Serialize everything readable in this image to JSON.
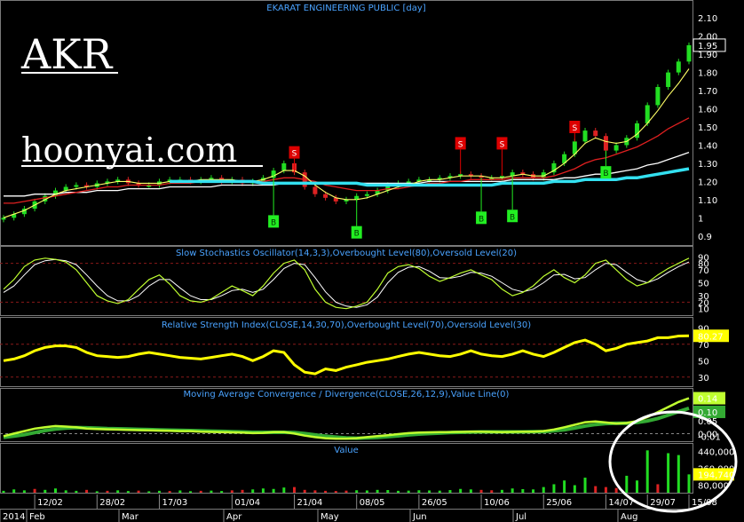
{
  "title": "EKARAT ENGINEERING PUBLIC [day]",
  "overlay": {
    "ticker": "AKR",
    "site": "hoonyai.com"
  },
  "colors": {
    "up": "#22dd22",
    "down": "#dd2222",
    "grid": "#8a1a1a",
    "cyan": "#33e0f0",
    "signal_s": "#dd0000",
    "signal_b": "#22ee22"
  },
  "panels": {
    "price": {
      "ticks": [
        "2.10",
        "2.00",
        "1.90",
        "1.80",
        "1.70",
        "1.60",
        "1.50",
        "1.40",
        "1.30",
        "1.20",
        "1.10",
        "1",
        "0.9"
      ],
      "last_label": "1.95",
      "buy_label": "B",
      "sell_label": "S"
    },
    "stochastic": {
      "title": "Slow Stochastics Oscillator(14,3,3),Overbought Level(80),Oversold Level(20)",
      "ticks": [
        "90",
        "80",
        "70",
        "50",
        "30",
        "20",
        "10"
      ]
    },
    "rsi": {
      "title": "Relative Strength Index(CLOSE,14,30,70),Overbought Level(70),Oversold Level(30)",
      "ticks": [
        "90",
        "70",
        "50",
        "30"
      ],
      "last_label": "80.27"
    },
    "macd": {
      "title": "Moving Average Convergence / Divergence(CLOSE,26,12,9),Value Line(0)",
      "ticks": [
        "0.05",
        "0.00",
        "-0.01"
      ],
      "last_labels": [
        "0.14",
        "0.10"
      ]
    },
    "value": {
      "title": "Value",
      "ticks": [
        "440,000",
        "260,000",
        "80,000"
      ],
      "last_label": "194,740"
    }
  },
  "x_axis": {
    "dates": [
      "12/02",
      "28/02",
      "17/03",
      "01/04",
      "21/04",
      "08/05",
      "26/05",
      "10/06",
      "25/06",
      "14/07",
      "29/07",
      "15/08"
    ],
    "months": [
      "2014",
      "Feb",
      "Mar",
      "Apr",
      "May",
      "Jun",
      "Jul",
      "Aug"
    ]
  },
  "chart_data": {
    "type": "line",
    "x_range": [
      "2014-01",
      "2014-08-20"
    ],
    "price": {
      "ylim": [
        0.85,
        2.15
      ],
      "close": [
        1.0,
        1.02,
        1.05,
        1.09,
        1.12,
        1.15,
        1.17,
        1.18,
        1.17,
        1.19,
        1.2,
        1.21,
        1.19,
        1.18,
        1.18,
        1.2,
        1.21,
        1.21,
        1.2,
        1.21,
        1.22,
        1.2,
        1.21,
        1.19,
        1.2,
        1.22,
        1.26,
        1.3,
        1.25,
        1.17,
        1.13,
        1.11,
        1.09,
        1.1,
        1.12,
        1.13,
        1.15,
        1.18,
        1.19,
        1.2,
        1.21,
        1.21,
        1.22,
        1.23,
        1.24,
        1.23,
        1.22,
        1.22,
        1.23,
        1.25,
        1.24,
        1.22,
        1.25,
        1.3,
        1.35,
        1.42,
        1.48,
        1.45,
        1.37,
        1.4,
        1.44,
        1.52,
        1.62,
        1.72,
        1.8,
        1.86,
        1.95
      ],
      "sma_fast": [
        1.0,
        1.02,
        1.04,
        1.07,
        1.1,
        1.13,
        1.15,
        1.16,
        1.17,
        1.18,
        1.19,
        1.2,
        1.2,
        1.19,
        1.19,
        1.19,
        1.2,
        1.2,
        1.2,
        1.21,
        1.21,
        1.21,
        1.21,
        1.2,
        1.2,
        1.21,
        1.23,
        1.26,
        1.26,
        1.23,
        1.18,
        1.14,
        1.11,
        1.1,
        1.1,
        1.11,
        1.13,
        1.15,
        1.17,
        1.18,
        1.2,
        1.21,
        1.21,
        1.22,
        1.23,
        1.23,
        1.23,
        1.22,
        1.22,
        1.23,
        1.24,
        1.23,
        1.23,
        1.26,
        1.3,
        1.35,
        1.41,
        1.44,
        1.42,
        1.41,
        1.42,
        1.46,
        1.52,
        1.59,
        1.67,
        1.74,
        1.82
      ],
      "sma_mid": [
        1.08,
        1.08,
        1.09,
        1.1,
        1.11,
        1.12,
        1.13,
        1.14,
        1.15,
        1.16,
        1.17,
        1.17,
        1.18,
        1.18,
        1.18,
        1.18,
        1.19,
        1.19,
        1.19,
        1.2,
        1.2,
        1.2,
        1.2,
        1.2,
        1.2,
        1.2,
        1.21,
        1.22,
        1.22,
        1.21,
        1.2,
        1.18,
        1.17,
        1.16,
        1.15,
        1.15,
        1.15,
        1.16,
        1.16,
        1.17,
        1.18,
        1.19,
        1.19,
        1.2,
        1.2,
        1.21,
        1.21,
        1.21,
        1.21,
        1.22,
        1.22,
        1.22,
        1.22,
        1.23,
        1.25,
        1.27,
        1.3,
        1.32,
        1.33,
        1.35,
        1.37,
        1.39,
        1.42,
        1.45,
        1.49,
        1.52,
        1.55
      ],
      "sma_slow": [
        1.12,
        1.12,
        1.12,
        1.13,
        1.13,
        1.13,
        1.14,
        1.14,
        1.14,
        1.15,
        1.15,
        1.15,
        1.16,
        1.16,
        1.16,
        1.16,
        1.17,
        1.17,
        1.17,
        1.17,
        1.17,
        1.18,
        1.18,
        1.18,
        1.18,
        1.18,
        1.18,
        1.19,
        1.19,
        1.19,
        1.19,
        1.19,
        1.19,
        1.19,
        1.19,
        1.19,
        1.19,
        1.19,
        1.19,
        1.19,
        1.19,
        1.2,
        1.2,
        1.2,
        1.2,
        1.2,
        1.2,
        1.2,
        1.2,
        1.21,
        1.21,
        1.21,
        1.21,
        1.21,
        1.22,
        1.22,
        1.23,
        1.24,
        1.24,
        1.25,
        1.26,
        1.27,
        1.29,
        1.3,
        1.32,
        1.34,
        1.36
      ],
      "cyan_band": [
        null,
        null,
        null,
        null,
        null,
        null,
        null,
        null,
        null,
        null,
        null,
        null,
        null,
        null,
        null,
        null,
        1.2,
        1.2,
        1.2,
        1.2,
        1.2,
        1.2,
        1.2,
        1.2,
        1.2,
        1.19,
        1.19,
        1.19,
        1.19,
        1.19,
        1.19,
        1.19,
        1.19,
        1.19,
        1.19,
        1.18,
        1.18,
        1.18,
        1.18,
        1.18,
        1.18,
        1.18,
        1.18,
        1.18,
        1.18,
        1.18,
        1.18,
        1.18,
        1.19,
        1.19,
        1.19,
        1.19,
        1.19,
        1.2,
        1.2,
        1.2,
        1.21,
        1.21,
        1.21,
        1.21,
        1.22,
        1.22,
        1.23,
        1.24,
        1.25,
        1.26,
        1.27
      ],
      "signals": [
        {
          "i": 26,
          "t": "B",
          "v": 0.98
        },
        {
          "i": 28,
          "t": "S",
          "v": 1.36
        },
        {
          "i": 34,
          "t": "B",
          "v": 0.92
        },
        {
          "i": 44,
          "t": "S",
          "v": 1.41
        },
        {
          "i": 46,
          "t": "B",
          "v": 1.0
        },
        {
          "i": 48,
          "t": "S",
          "v": 1.41
        },
        {
          "i": 49,
          "t": "B",
          "v": 1.01
        },
        {
          "i": 55,
          "t": "S",
          "v": 1.5
        },
        {
          "i": 58,
          "t": "B",
          "v": 1.25
        }
      ]
    },
    "stochastic": {
      "ylim": [
        0,
        100
      ],
      "overbought": 80,
      "oversold": 20,
      "k": [
        40,
        55,
        75,
        85,
        88,
        86,
        82,
        70,
        50,
        30,
        22,
        18,
        24,
        40,
        55,
        62,
        48,
        30,
        22,
        20,
        25,
        35,
        45,
        38,
        30,
        45,
        65,
        80,
        85,
        70,
        40,
        20,
        12,
        10,
        14,
        20,
        40,
        65,
        75,
        78,
        72,
        60,
        52,
        58,
        65,
        70,
        62,
        55,
        40,
        30,
        35,
        45,
        60,
        70,
        58,
        50,
        62,
        80,
        85,
        70,
        55,
        45,
        50,
        62,
        72,
        80,
        88
      ],
      "d": [
        35,
        45,
        62,
        78,
        84,
        86,
        84,
        78,
        62,
        45,
        30,
        22,
        22,
        30,
        45,
        55,
        55,
        42,
        30,
        24,
        24,
        30,
        38,
        40,
        35,
        40,
        55,
        72,
        80,
        78,
        58,
        36,
        20,
        14,
        12,
        16,
        28,
        50,
        66,
        74,
        75,
        68,
        58,
        57,
        60,
        66,
        65,
        60,
        50,
        40,
        36,
        40,
        50,
        62,
        63,
        56,
        58,
        70,
        80,
        78,
        66,
        55,
        50,
        56,
        66,
        75,
        82
      ]
    },
    "rsi": {
      "ylim": [
        20,
        100
      ],
      "overbought": 70,
      "oversold": 30,
      "values": [
        50,
        52,
        56,
        62,
        66,
        68,
        68,
        66,
        60,
        56,
        55,
        54,
        55,
        58,
        60,
        58,
        56,
        54,
        53,
        52,
        54,
        56,
        58,
        55,
        50,
        55,
        62,
        60,
        45,
        36,
        34,
        40,
        38,
        42,
        45,
        48,
        50,
        52,
        55,
        58,
        60,
        58,
        56,
        55,
        58,
        62,
        58,
        56,
        55,
        58,
        62,
        58,
        55,
        60,
        66,
        72,
        75,
        70,
        62,
        65,
        70,
        72,
        74,
        78,
        78,
        80,
        80.27
      ]
    },
    "macd": {
      "ylim": [
        -0.03,
        0.17
      ],
      "macd": [
        -0.01,
        0.0,
        0.01,
        0.02,
        0.025,
        0.03,
        0.028,
        0.025,
        0.02,
        0.018,
        0.017,
        0.016,
        0.015,
        0.014,
        0.013,
        0.012,
        0.011,
        0.01,
        0.01,
        0.008,
        0.007,
        0.006,
        0.005,
        0.004,
        0.002,
        0.003,
        0.006,
        0.006,
        0.0,
        -0.008,
        -0.014,
        -0.018,
        -0.02,
        -0.02,
        -0.018,
        -0.014,
        -0.01,
        -0.006,
        -0.002,
        0.002,
        0.004,
        0.005,
        0.006,
        0.006,
        0.007,
        0.008,
        0.008,
        0.007,
        0.006,
        0.007,
        0.008,
        0.008,
        0.01,
        0.016,
        0.025,
        0.035,
        0.045,
        0.048,
        0.044,
        0.04,
        0.042,
        0.05,
        0.065,
        0.085,
        0.105,
        0.125,
        0.14
      ],
      "signal": [
        -0.015,
        -0.01,
        -0.004,
        0.004,
        0.012,
        0.018,
        0.022,
        0.024,
        0.023,
        0.022,
        0.02,
        0.019,
        0.018,
        0.017,
        0.016,
        0.015,
        0.014,
        0.013,
        0.012,
        0.011,
        0.01,
        0.009,
        0.008,
        0.007,
        0.005,
        0.005,
        0.005,
        0.005,
        0.004,
        0.0,
        -0.005,
        -0.01,
        -0.014,
        -0.017,
        -0.018,
        -0.017,
        -0.015,
        -0.012,
        -0.009,
        -0.005,
        -0.002,
        0.0,
        0.002,
        0.004,
        0.005,
        0.006,
        0.007,
        0.007,
        0.007,
        0.007,
        0.007,
        0.008,
        0.008,
        0.011,
        0.015,
        0.022,
        0.03,
        0.036,
        0.04,
        0.041,
        0.041,
        0.044,
        0.05,
        0.06,
        0.073,
        0.087,
        0.1
      ],
      "zero": 0
    },
    "value": {
      "ylim": [
        0,
        500000
      ],
      "values": [
        20000,
        35000,
        25000,
        40000,
        30000,
        45000,
        25000,
        20000,
        30000,
        15000,
        20000,
        25000,
        18000,
        22000,
        15000,
        20000,
        18000,
        24000,
        16000,
        20000,
        22000,
        18000,
        25000,
        30000,
        35000,
        45000,
        40000,
        55000,
        60000,
        30000,
        25000,
        20000,
        18000,
        22000,
        26000,
        24000,
        30000,
        28000,
        20000,
        22000,
        26000,
        24000,
        22000,
        28000,
        40000,
        35000,
        30000,
        26000,
        30000,
        45000,
        38000,
        35000,
        60000,
        90000,
        130000,
        80000,
        160000,
        70000,
        60000,
        50000,
        180000,
        130000,
        450000,
        90000,
        420000,
        400000,
        194740
      ],
      "down": [
        3,
        8,
        10,
        13,
        16,
        19,
        22,
        23,
        28,
        29,
        30,
        31,
        32,
        33,
        46,
        47,
        57,
        58,
        59,
        63
      ]
    }
  }
}
